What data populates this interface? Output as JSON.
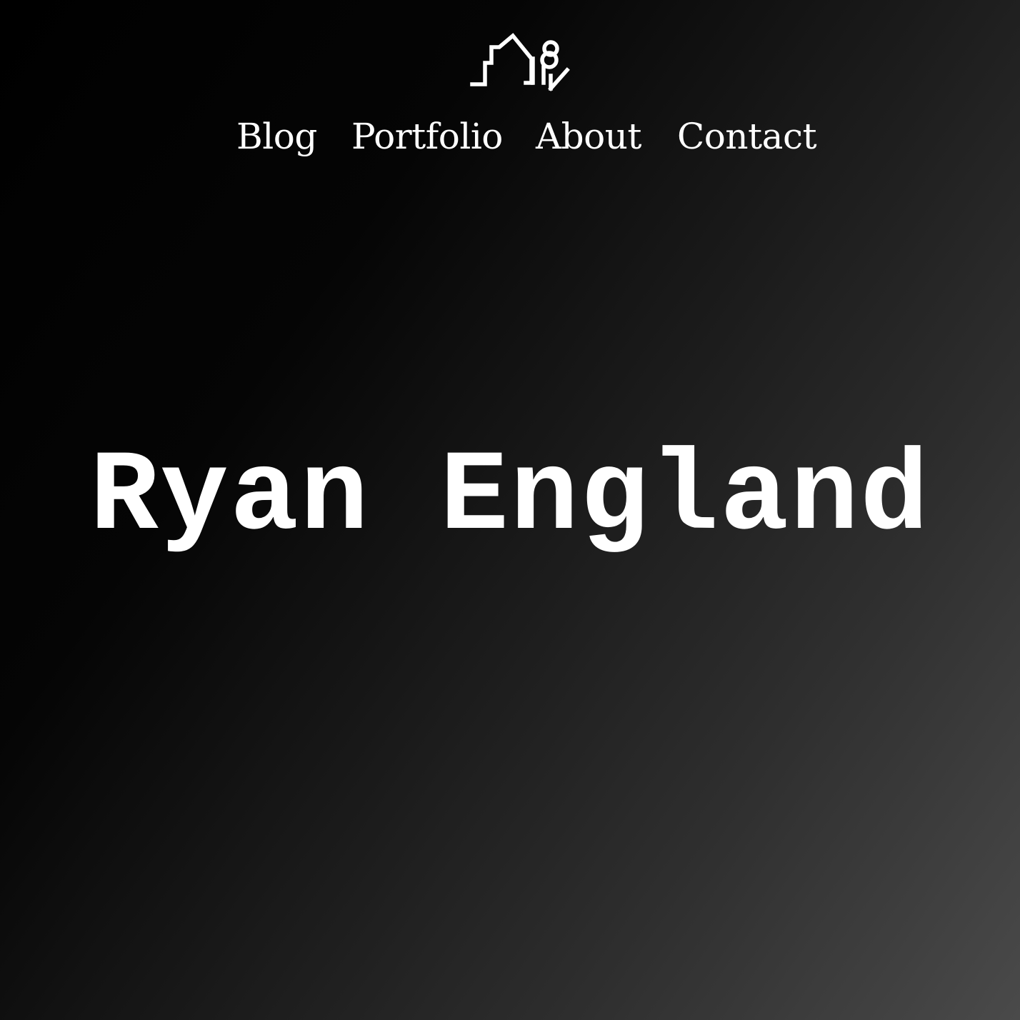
{
  "header": {
    "logo_icon": "house-tree-logo-icon",
    "nav": [
      {
        "label": "Blog"
      },
      {
        "label": "Portfolio"
      },
      {
        "label": "About"
      },
      {
        "label": "Contact"
      }
    ]
  },
  "hero": {
    "title": "Ryan England"
  },
  "colors": {
    "text": "#ffffff",
    "background_start": "#000000",
    "background_end": "#4a4a4a"
  }
}
